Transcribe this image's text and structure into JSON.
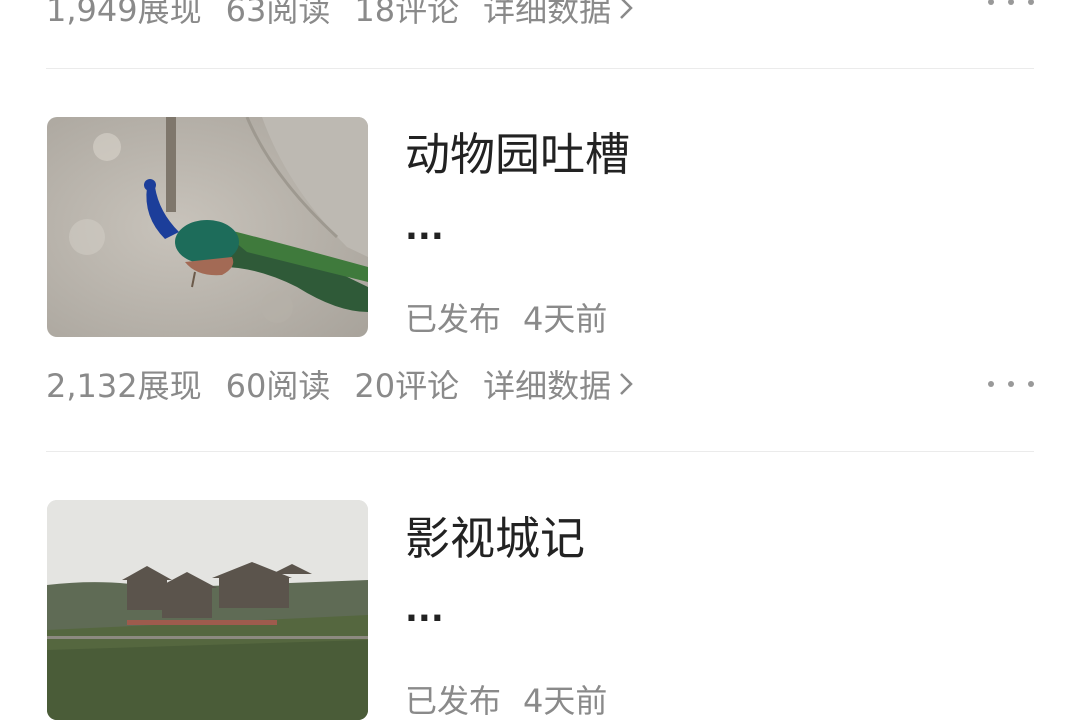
{
  "articles": [
    {
      "stats": {
        "impressions": "1,949展现",
        "reads": "63阅读",
        "comments": "18评论",
        "detail": "详细数据"
      }
    },
    {
      "title": "动物园吐槽",
      "excerpt": "...",
      "status": "已发布",
      "time": "4天前",
      "stats": {
        "impressions": "2,132展现",
        "reads": "60阅读",
        "comments": "20评论",
        "detail": "详细数据"
      }
    },
    {
      "title": "影视城记",
      "excerpt": "...",
      "status": "已发布",
      "time": "4天前"
    }
  ],
  "icons": {
    "more": "more-horizontal-icon",
    "chevron": "chevron-right-icon"
  },
  "colors": {
    "background": "#ffffff",
    "text": "#222222",
    "muted": "#8a8a8a",
    "divider": "#ebebeb"
  }
}
